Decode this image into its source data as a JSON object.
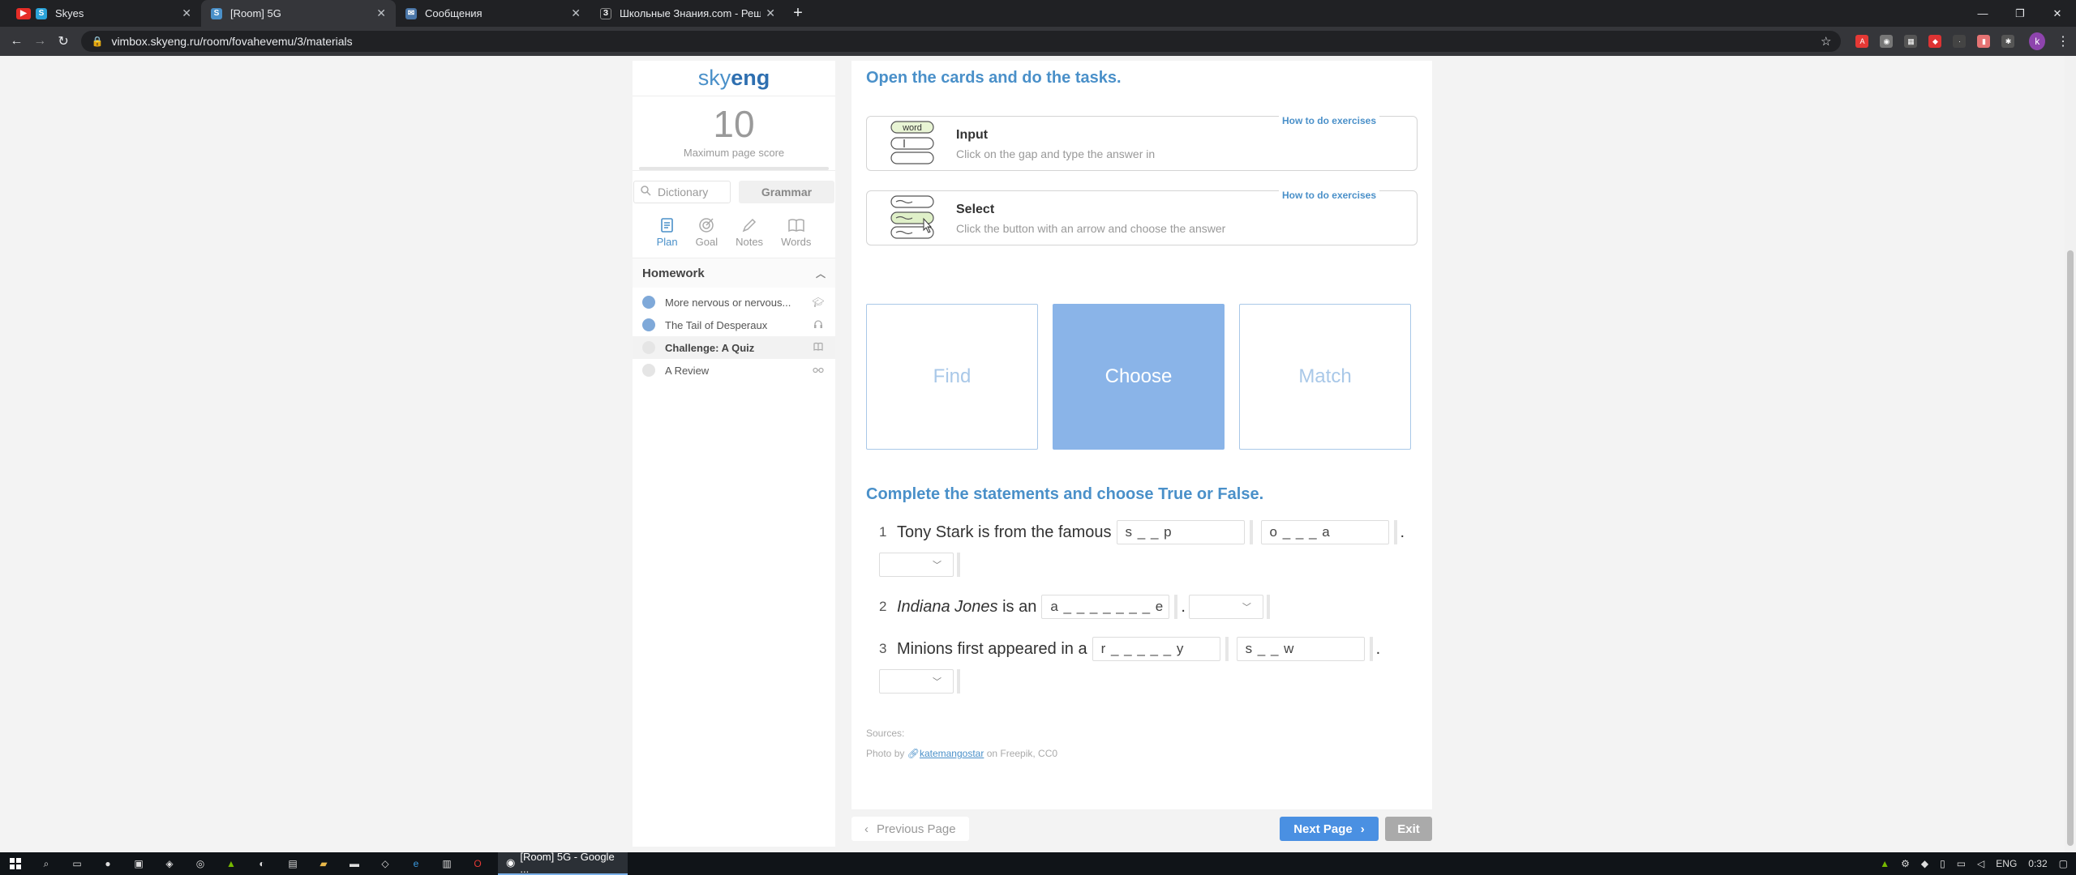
{
  "browser": {
    "tabs": [
      {
        "title": "Skyes",
        "favicon": "S",
        "color": "#2aa3d9"
      },
      {
        "title": "[Room] 5G",
        "favicon": "S",
        "color": "#4a90c9"
      },
      {
        "title": "Сообщения",
        "favicon": "✉",
        "color": "#4a76a8"
      },
      {
        "title": "Школьные Знания.com - Решае",
        "favicon": "З",
        "color": "#202124"
      }
    ],
    "url": "vimbox.skyeng.ru/room/fovahevemu/3/materials",
    "profile_initial": "k"
  },
  "sidebar": {
    "logo_a": "sky",
    "logo_b": "eng",
    "score": "10",
    "score_label": "Maximum page score",
    "dictionary_placeholder": "Dictionary",
    "grammar_label": "Grammar",
    "modes": [
      {
        "label": "Plan",
        "icon": "plan-icon"
      },
      {
        "label": "Goal",
        "icon": "goal-icon"
      },
      {
        "label": "Notes",
        "icon": "notes-icon"
      },
      {
        "label": "Words",
        "icon": "words-icon"
      }
    ],
    "homework_title": "Homework",
    "homework": [
      {
        "title": "More nervous or nervous...",
        "status": "done",
        "icon": "graduation-cap-icon"
      },
      {
        "title": "The Tail of Desperaux",
        "status": "done",
        "icon": "headphones-icon"
      },
      {
        "title": "Challenge: A Quiz",
        "status": "todo",
        "icon": "book-icon"
      },
      {
        "title": "A Review",
        "status": "todo",
        "icon": "glasses-icon"
      }
    ]
  },
  "main": {
    "title": "Open the cards and do the tasks.",
    "howto_link": "How to do exercises",
    "cards": [
      {
        "name": "Input",
        "desc": "Click on the gap and type the answer in",
        "pic_word": "word"
      },
      {
        "name": "Select",
        "desc": "Click the button with an arrow and choose the answer"
      }
    ],
    "choices": [
      "Find",
      "Choose",
      "Match"
    ],
    "selected_choice": "Choose",
    "task_title": "Complete the statements and choose True or False.",
    "statements": [
      {
        "n": "1",
        "before": "Tony Stark is from the famous",
        "gap1": "s _ _ p",
        "gap2": "o _ _ _ a",
        "end": "."
      },
      {
        "n": "2",
        "before_italic": "Indiana Jones",
        "before": "is an",
        "gap1": "a _ _ _ _ _ _ _ e",
        "end": "."
      },
      {
        "n": "3",
        "before": "Minions first appeared in a",
        "gap1": "r _ _ _ _ _ y",
        "gap2": "s _ _ w",
        "end": "."
      }
    ],
    "sources_label": "Sources:",
    "photo_prefix": "Photo by",
    "photo_author": "katemangostar",
    "photo_suffix": "on Freepik, CC0"
  },
  "nav": {
    "prev": "Previous Page",
    "next": "Next Page",
    "exit": "Exit"
  },
  "taskbar": {
    "active_app": "[Room] 5G - Google ...",
    "lang": "ENG",
    "time": "0:32"
  },
  "colors": {
    "accent": "#4a90c9",
    "selected_card": "#8ab4e8",
    "next_button": "#4a90e2"
  }
}
